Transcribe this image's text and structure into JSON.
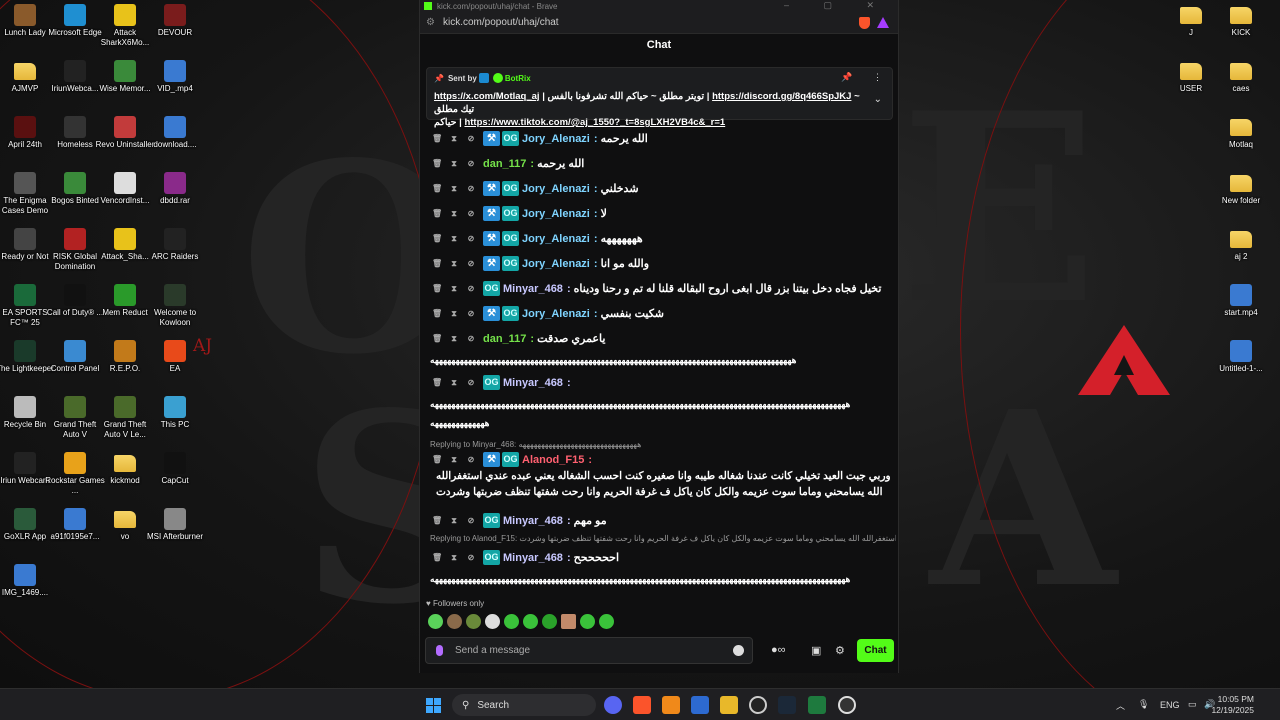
{
  "browser": {
    "window_title": "kick.com/popout/uhaj/chat - Brave",
    "url": "kick.com/popout/uhaj/chat"
  },
  "chat": {
    "header": "Chat",
    "pinned": {
      "sent_by_label": "Sent by",
      "bot_name": "BotRix",
      "text_part1": "https://x.com/Motlaq_aj",
      "text_part2": "| تويتر مطلق ~ حياكم الله تشرفونا بالفس |",
      "text_part3": "https://discord.gg/8q466SpJKJ",
      "text_part4": "~ تيك مطلق",
      "text_part5": "حياكم |",
      "text_part6": "https://www.tiktok.com/@aj_1550?_t=8sgLXH2VB4c&_r=1"
    },
    "messages": [
      {
        "user": "Jory_Alenazi",
        "text": "الله يرحمه"
      },
      {
        "user": "dan_117",
        "text": "الله يرحمه"
      },
      {
        "user": "Jory_Alenazi",
        "text": "شدخلني"
      },
      {
        "user": "Jory_Alenazi",
        "text": "لا"
      },
      {
        "user": "Jory_Alenazi",
        "text": "هههههههه"
      },
      {
        "user": "Jory_Alenazi",
        "text": "والله مو انا"
      },
      {
        "user": "Minyar_468",
        "text": "تخيل فجاه دخل بيتنا بزر قال ابغى اروح البقاله قلنا له تم و رحنا وديناه"
      },
      {
        "user": "Jory_Alenazi",
        "text": "شكيت بنفسي"
      },
      {
        "user": "dan_117",
        "text": "ياعمري صدقت"
      },
      {
        "user": "Minyar_468",
        "text": ""
      },
      {
        "user": "Alanod_F15",
        "text": "وربي جبت العيد تخيلي كانت عندنا شغاله طيبه وانا صغيره كنت احسب الشغاله يعني عبده عندي استغفرالله الله يسامحني وماما سوت عزيمه والكل كان ياكل ف غرفة الحريم وانا رحت شفتها تنظف ضربتها وشردت"
      },
      {
        "user": "Minyar_468",
        "text": "مو مهم"
      },
      {
        "user": "Minyar_468",
        "text": "احححححح"
      }
    ],
    "long_laugh_1": "هههههههههههههههههههههههههههههههههههههههههههههههههههههههههههههههههههههههههههههههههههههههه",
    "long_laugh_2": "ههههههههههههههههههههههههههههههههههههههههههههههههههههههههههههههههههههههههههههههههههههههههههههههههههههه",
    "long_laugh_3": "هههههههههههههه",
    "reply_1": "Replying to Minyar_468: ههههههههههههههههههههههههههههههههه",
    "reply_2": "Replying to Alanod_F15: وربي جبت العيد تخيلي كانت عندنا شغاله طيبه وانا صغيره كنت احسب الشغاله يعني عبده عندي استغفرالله الله يسامحني وماما سوت عزيمه والكل كان ياكل ف غرفة الحريم وانا رحت شفتها تنظف ضربتها وشردت ...",
    "followers_only": "Followers only",
    "input_placeholder": "Send a message",
    "send_button": "Chat"
  },
  "desktop_left": [
    {
      "label": "Lunch Lady",
      "color": "#8a5a2b"
    },
    {
      "label": "Microsoft Edge",
      "color": "#1f8fd1"
    },
    {
      "label": "Attack SharkX6Mo...",
      "color": "#e8c21a"
    },
    {
      "label": "DEVOUR",
      "color": "#7a1c1c"
    },
    {
      "label": "AJMVP",
      "color": "folder"
    },
    {
      "label": "IriunWebca...",
      "color": "#222"
    },
    {
      "label": "Wise Memor...",
      "color": "#3a8a3a"
    },
    {
      "label": "VID_.mp4",
      "color": "#3a7ad1"
    },
    {
      "label": "April 24th",
      "color": "#5a1010"
    },
    {
      "label": "Homeless",
      "color": "#333"
    },
    {
      "label": "Revo Uninstaller",
      "color": "#c23b3b"
    },
    {
      "label": "download....",
      "color": "#3a7ad1"
    },
    {
      "label": "The Enigma Cases Demo",
      "color": "#555"
    },
    {
      "label": "Bogos Binted",
      "color": "#3a8a3a"
    },
    {
      "label": "VencordInst...",
      "color": "#ddd"
    },
    {
      "label": "dbdd.rar",
      "color": "#8a2a8a"
    },
    {
      "label": "Ready or Not",
      "color": "#444"
    },
    {
      "label": "RISK Global Domination",
      "color": "#b22222"
    },
    {
      "label": "Attack_Sha...",
      "color": "#e8c21a"
    },
    {
      "label": "ARC Raiders",
      "color": "#222"
    },
    {
      "label": "EA SPORTS FC™ 25",
      "color": "#1a6a3a"
    },
    {
      "label": "Call of Duty® ...",
      "color": "#111"
    },
    {
      "label": "Mem Reduct",
      "color": "#2a9a2a"
    },
    {
      "label": "Welcome to Kowloon",
      "color": "#2a3a2a"
    },
    {
      "label": "The Lightkeeper",
      "color": "#1a3a2a"
    },
    {
      "label": "Control Panel",
      "color": "#3a8ad1"
    },
    {
      "label": "R.E.P.O.",
      "color": "#c27a1a"
    },
    {
      "label": "EA",
      "color": "#e84a1a"
    },
    {
      "label": "Recycle Bin",
      "color": "#bbb"
    },
    {
      "label": "Grand Theft Auto V",
      "color": "#4a6a2a"
    },
    {
      "label": "Grand Theft Auto V Le...",
      "color": "#4a6a2a"
    },
    {
      "label": "This PC",
      "color": "#3aa0d1"
    },
    {
      "label": "Iriun Webcam",
      "color": "#222"
    },
    {
      "label": "Rockstar Games ...",
      "color": "#e8a21a"
    },
    {
      "label": "kickmod",
      "color": "folder"
    },
    {
      "label": "CapCut",
      "color": "#111"
    },
    {
      "label": "GoXLR App",
      "color": "#2a5a3a"
    },
    {
      "label": "a91f0195e7...",
      "color": "#3a7ad1"
    },
    {
      "label": "vo",
      "color": "folder"
    },
    {
      "label": "MSI Afterburner",
      "color": "#888"
    },
    {
      "label": "IMG_1469....",
      "color": "#3a7ad1"
    }
  ],
  "desktop_right": [
    {
      "label": "J",
      "color": "folder"
    },
    {
      "label": "KICK",
      "color": "folder"
    },
    {
      "label": "USER",
      "color": "folder"
    },
    {
      "label": "caes",
      "color": "folder"
    },
    {
      "label": "Motlaq",
      "color": "folder"
    },
    {
      "label": "New folder",
      "color": "folder"
    },
    {
      "label": "aj 2",
      "color": "folder"
    },
    {
      "label": "start.mp4",
      "color": "#3a7ad1"
    },
    {
      "label": "Untitled-1-...",
      "color": "#3a7ad1"
    }
  ],
  "wallpaper_text": "AJ",
  "taskbar": {
    "search_label": "Search",
    "language": "ENG",
    "time": "10:05 PM",
    "date": "12/19/2025"
  }
}
